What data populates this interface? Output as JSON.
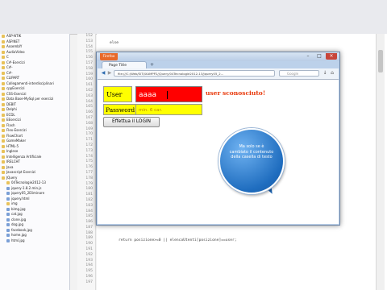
{
  "firefox": {
    "menu_button_label": "Firefox",
    "tab_title": "Page Title",
    "url": "file:///C:/Web/SITI/XAMPP2/jQuery/04Tecnologie2012-13/jquery05_2...",
    "search_placeholder": "Google"
  },
  "page": {
    "user_label": "User",
    "user_value": "aaaa",
    "user_message": "user sconosciuto!",
    "password_label": "Password",
    "password_placeholder": "min. 6 car.",
    "login_button": "Effettua il LOGIN"
  },
  "bubble": {
    "line1": "Ma solo se è",
    "line2": "cambiato il contenuto",
    "line3": "della casella di testo"
  },
  "editor": {
    "top_code": "else",
    "bottom_code": "return posizione>=0 || elencoUtenti[posizione]==user;",
    "line_numbers": [
      "152",
      "153",
      "154",
      "155",
      "156",
      "157",
      "158",
      "159",
      "160",
      "161",
      "162",
      "163",
      "164",
      "165",
      "166",
      "167",
      "168",
      "169",
      "170",
      "171",
      "172",
      "173",
      "174",
      "175",
      "176",
      "177",
      "178",
      "179",
      "180",
      "181",
      "182",
      "183",
      "184",
      "185",
      "186",
      "187",
      "188",
      "189",
      "190",
      "191",
      "192",
      "193",
      "194",
      "195",
      "196",
      "197"
    ]
  },
  "tree": {
    "items": [
      {
        "label": "ASP-NTIK",
        "type": "folder"
      },
      {
        "label": "ASP.NET",
        "type": "folder"
      },
      {
        "label": "AssemblY",
        "type": "folder"
      },
      {
        "label": "AudioVideo",
        "type": "folder"
      },
      {
        "label": "C",
        "type": "folder"
      },
      {
        "label": "C#-Esercizi",
        "type": "folder"
      },
      {
        "label": "C#-",
        "type": "folder"
      },
      {
        "label": "C#-",
        "type": "folder"
      },
      {
        "label": "CLIPART",
        "type": "folder"
      },
      {
        "label": "Collegamenti-interdisciplinari",
        "type": "folder"
      },
      {
        "label": "cppEsercizi",
        "type": "folder"
      },
      {
        "label": "CSS-Esercizi",
        "type": "folder"
      },
      {
        "label": "Data Base-MySql per esercizi",
        "type": "folder"
      },
      {
        "label": "DEBIT",
        "type": "folder"
      },
      {
        "label": "Delphi",
        "type": "folder"
      },
      {
        "label": "ECDL",
        "type": "folder"
      },
      {
        "label": "EEsercizi",
        "type": "folder"
      },
      {
        "label": "Flash",
        "type": "folder"
      },
      {
        "label": "Flex-Esercizi",
        "type": "folder"
      },
      {
        "label": "FlowChart",
        "type": "folder"
      },
      {
        "label": "GameMaker",
        "type": "folder"
      },
      {
        "label": "HTML-5",
        "type": "folder"
      },
      {
        "label": "Inglese",
        "type": "folder"
      },
      {
        "label": "Intelligenza Artificiale",
        "type": "folder"
      },
      {
        "label": "IRELCHT",
        "type": "folder"
      },
      {
        "label": "Java",
        "type": "folder"
      },
      {
        "label": "Javascript Esercizi",
        "type": "folder"
      },
      {
        "label": "JQuery",
        "type": "folder"
      },
      {
        "label": "04Tecnologie2012-13",
        "type": "folder"
      },
      {
        "label": "jquery-1.8.2.min.js",
        "type": "file"
      },
      {
        "label": "jquery05_2Eliminare",
        "type": "file"
      },
      {
        "label": "jquery.html",
        "type": "file"
      },
      {
        "label": "img",
        "type": "folder"
      },
      {
        "label": "bimg.jpg",
        "type": "file"
      },
      {
        "label": "cat.jpg",
        "type": "file"
      },
      {
        "label": "clone.jpg",
        "type": "file"
      },
      {
        "label": "dog.jpg",
        "type": "file"
      },
      {
        "label": "facebook.jpg",
        "type": "file"
      },
      {
        "label": "home.jpg",
        "type": "file"
      },
      {
        "label": "html.jpg",
        "type": "file"
      }
    ]
  }
}
